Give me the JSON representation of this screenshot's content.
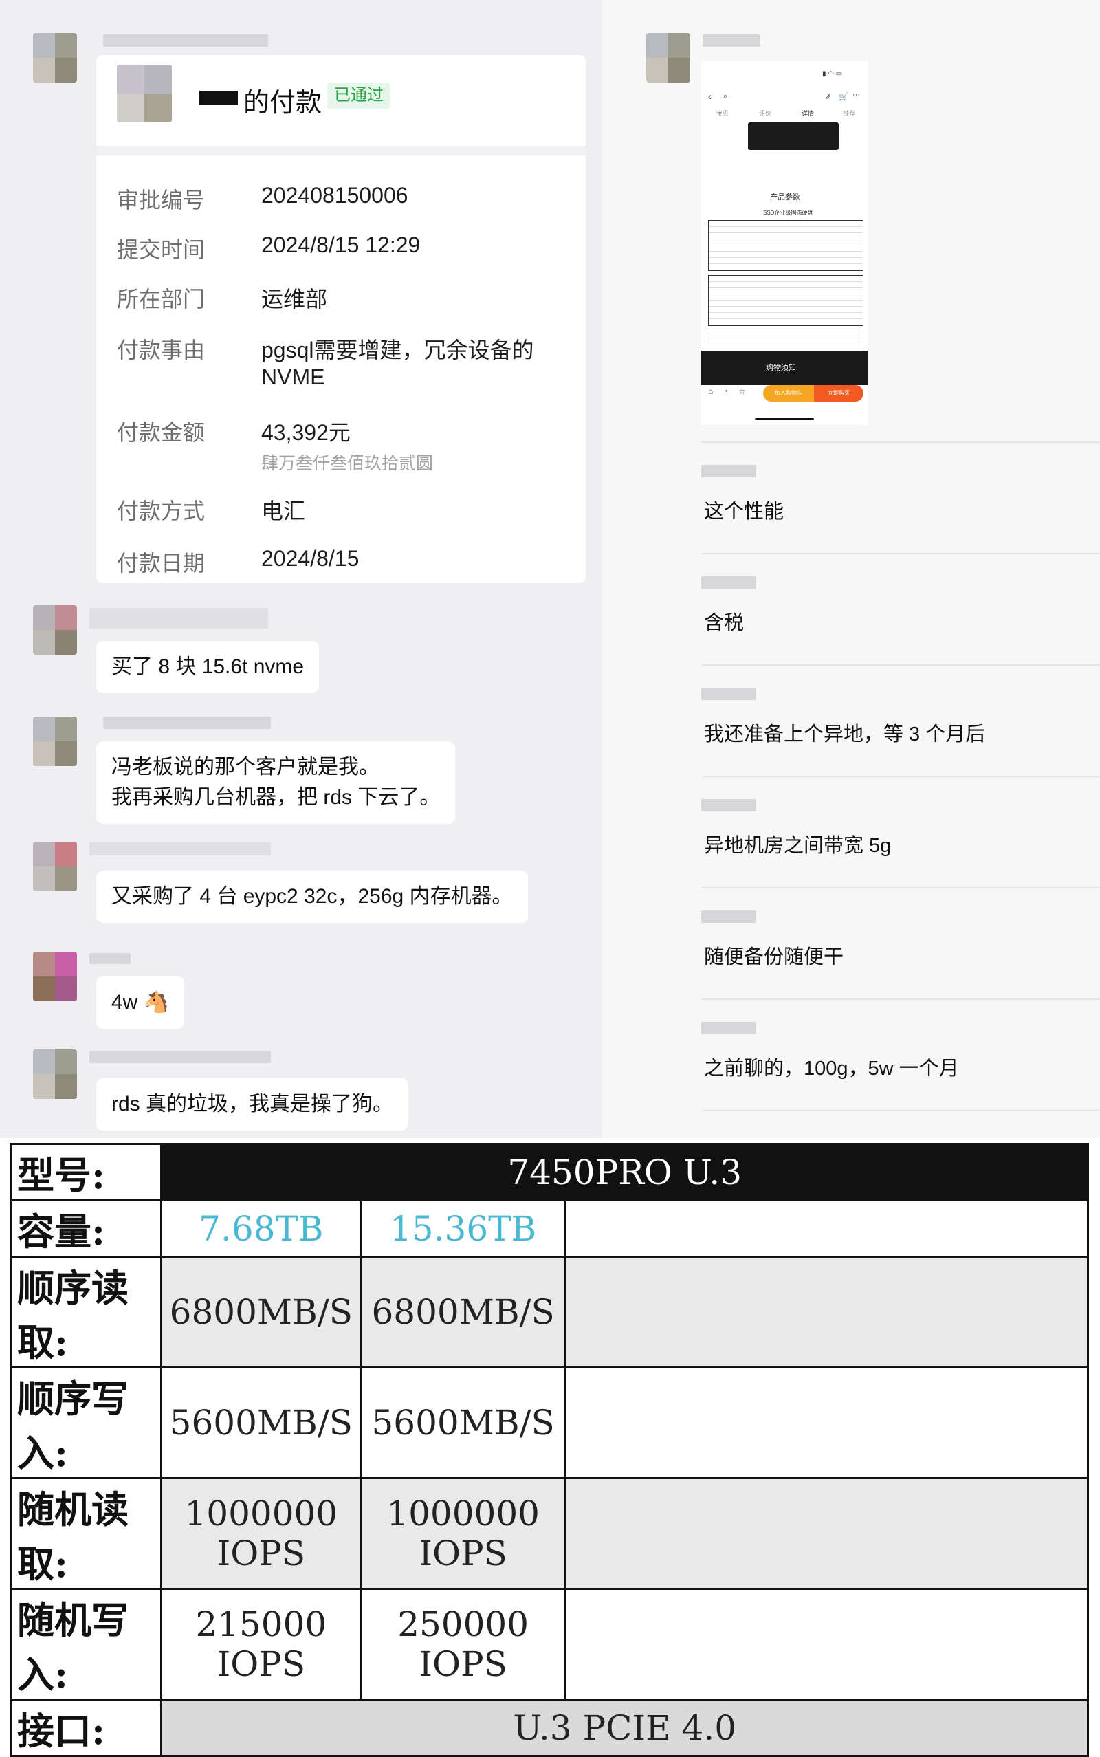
{
  "approval": {
    "title": "的付款",
    "status": "已通过",
    "fields": [
      {
        "label": "审批编号",
        "value": "202408150006"
      },
      {
        "label": "提交时间",
        "value": "2024/8/15 12:29"
      },
      {
        "label": "所在部门",
        "value": "运维部"
      },
      {
        "label": "付款事由",
        "value": "pgsql需要增建，冗余设备的",
        "value2": "NVME"
      },
      {
        "label": "付款金额",
        "value": "43,392元",
        "sub": "肆万叁仟叁佰玖拾贰圆"
      },
      {
        "label": "付款方式",
        "value": "电汇"
      },
      {
        "label": "付款日期",
        "value": "2024/8/15"
      }
    ]
  },
  "left_messages": [
    {
      "lines": [
        "买了 8 块 15.6t nvme"
      ]
    },
    {
      "lines": [
        "冯老板说的那个客户就是我。",
        "我再采购几台机器，把 rds 下云了。"
      ]
    },
    {
      "lines": [
        "又采购了 4 台 eypc2 32c，256g 内存机器。"
      ]
    },
    {
      "lines": [
        "4w 🐴"
      ]
    },
    {
      "lines": [
        "rds 真的垃圾，我真是操了狗。"
      ]
    }
  ],
  "right_messages": [
    "这个性能",
    "含税",
    "我还准备上个异地，等 3 个月后",
    "异地机房之间带宽 5g",
    "随便备份随便干",
    "之前聊的，100g，5w 一个月"
  ],
  "phone": {
    "section_title": "产品参数",
    "section_subtitle": "SSD企业级固态硬盘",
    "notice": "购物须知",
    "cart_button": "加入购物车",
    "buy_button": "立即购买",
    "nav_tabs": [
      "宝贝",
      "评价",
      "详情",
      "推荐"
    ]
  },
  "spec_table": {
    "header_label": "型号:",
    "model": "7450PRO  U.3",
    "rows": [
      {
        "label": "容量:",
        "v1": "7.68TB",
        "v2": "15.36TB"
      },
      {
        "label": "顺序读取:",
        "v1": "6800MB/S",
        "v2": "6800MB/S"
      },
      {
        "label": "顺序写入:",
        "v1": "5600MB/S",
        "v2": "5600MB/S"
      },
      {
        "label": "随机读取:",
        "v1": "1000000  IOPS",
        "v2": "1000000  IOPS"
      },
      {
        "label": "随机写入:",
        "v1": "215000  IOPS",
        "v2": "250000  IOPS"
      }
    ],
    "interface_label": "接口:",
    "interface": "U.3  PCIE  4.0"
  },
  "colors": {
    "badge_green": "#2aa34a",
    "capacity_cyan": "#49b8d3",
    "chat_bg": "#efeff1"
  }
}
